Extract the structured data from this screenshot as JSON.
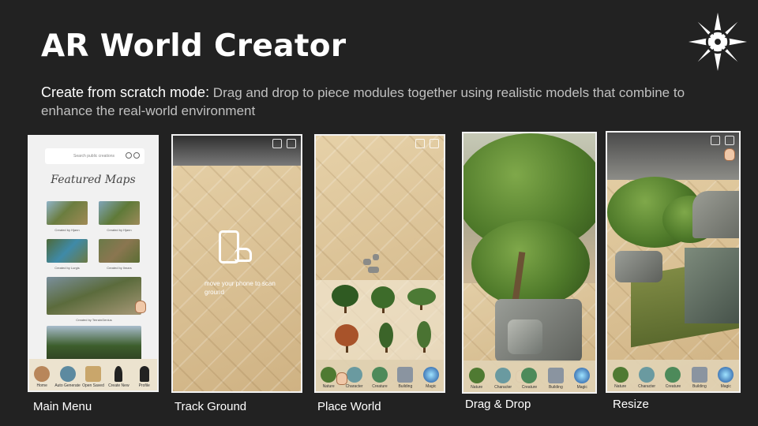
{
  "slide": {
    "title": "AR World Creator",
    "description_lead": "Create from scratch mode:",
    "description_rest": " Drag and drop to piece modules together using realistic models that combine to enhance the real-world environment"
  },
  "main_menu": {
    "search_placeholder": "Search public creations",
    "featured_title": "Featured Maps",
    "maps": [
      {
        "caption": "Created by Hjann"
      },
      {
        "caption": "Created by Hjann"
      },
      {
        "caption": "Created by Lurgis"
      },
      {
        "caption": "Created by Ilmars"
      },
      {
        "caption": "Created by TerrainGenius"
      }
    ],
    "menu": [
      "Home",
      "Auto Generate",
      "Open Saved",
      "Create New",
      "Profile"
    ]
  },
  "track_ground": {
    "instruction": "move your phone to scan ground"
  },
  "build_menu": [
    "Nature",
    "Character",
    "Creature",
    "Building",
    "Magic"
  ],
  "captions": {
    "main_menu": "Main Menu",
    "track_ground": "Track Ground",
    "place_world": "Place World",
    "drag_drop": "Drag & Drop",
    "resize": "Resize"
  }
}
